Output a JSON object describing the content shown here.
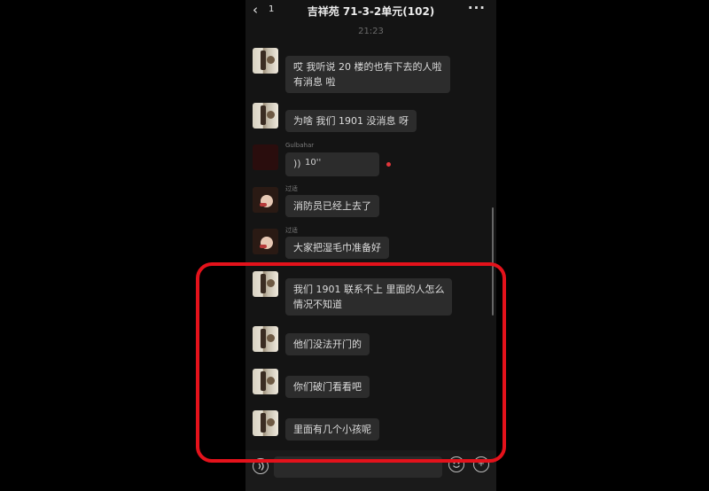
{
  "header": {
    "back_glyph": "‹",
    "unread_count": "1",
    "title": "吉祥苑 71-3-2单元(102)",
    "more_glyph": "···"
  },
  "timestamp": "21:23",
  "messages": [
    {
      "sender": "",
      "avatar": "room-photo-avatar",
      "text_lines": [
        "哎 我听说 20 楼的也有下去的人啦",
        "有消息 啦"
      ]
    },
    {
      "sender": "",
      "avatar": "room-photo-avatar",
      "text_lines": [
        "为啥 我们 1901 没消息 呀"
      ]
    },
    {
      "sender": "Gulbahar",
      "avatar": "dark-avatar",
      "type": "voice",
      "voice_icon": "))",
      "duration": "10''",
      "unread_dot_color": "#e0363b"
    },
    {
      "sender": "过适",
      "avatar": "face-avatar",
      "text_lines": [
        "消防员已经上去了"
      ]
    },
    {
      "sender": "过适",
      "avatar": "face-avatar",
      "text_lines": [
        "大家把湿毛巾准备好"
      ]
    },
    {
      "sender": "",
      "avatar": "room-photo-avatar",
      "text_lines": [
        "我们 1901 联系不上 里面的人怎么",
        "情况不知道"
      ]
    },
    {
      "sender": "",
      "avatar": "room-photo-avatar",
      "text_lines": [
        "他们没法开门的"
      ]
    },
    {
      "sender": "",
      "avatar": "room-photo-avatar",
      "text_lines": [
        "你们破门看看吧"
      ]
    },
    {
      "sender": "",
      "avatar": "room-photo-avatar",
      "text_lines": [
        "里面有几个小孩呢"
      ]
    }
  ],
  "input_bar": {
    "voice_icon": "voice-toggle-icon",
    "emoji_icon": "emoji-icon",
    "plus_icon": "plus-icon",
    "plus_glyph": "+"
  },
  "colors": {
    "highlight": "#e4121b",
    "bubble": "#2c2c2c",
    "background": "#141414"
  }
}
